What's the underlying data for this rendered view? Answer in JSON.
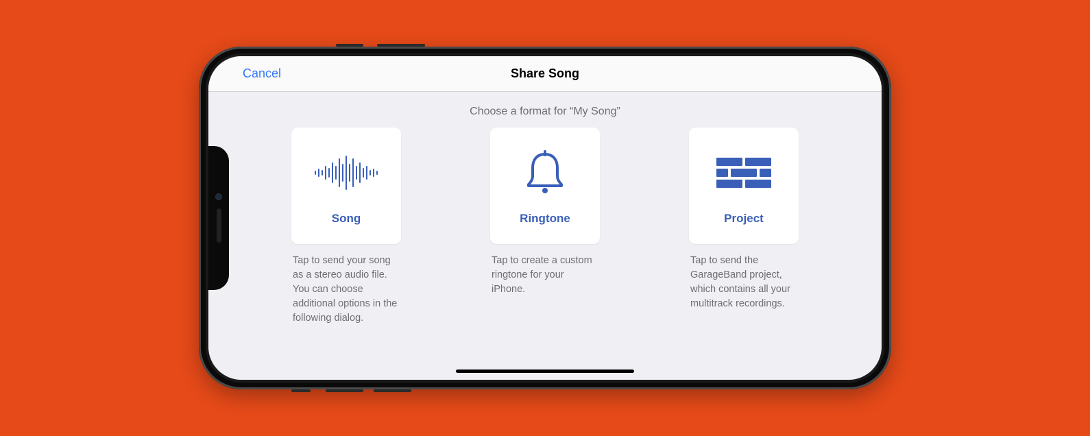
{
  "header": {
    "cancel": "Cancel",
    "title": "Share Song"
  },
  "subtitle": "Choose a format for “My Song”",
  "options": [
    {
      "icon": "waveform-icon",
      "label": "Song",
      "description": "Tap to send your song as a stereo audio file. You can choose additional options in the following dialog."
    },
    {
      "icon": "bell-icon",
      "label": "Ringtone",
      "description": "Tap to create a custom ringtone for your iPhone."
    },
    {
      "icon": "bricks-icon",
      "label": "Project",
      "description": "Tap to send the GarageBand project, which contains all your multitrack recordings."
    }
  ],
  "colors": {
    "background": "#e64a19",
    "accent": "#3478f6",
    "iconColor": "#3a5fb8"
  }
}
